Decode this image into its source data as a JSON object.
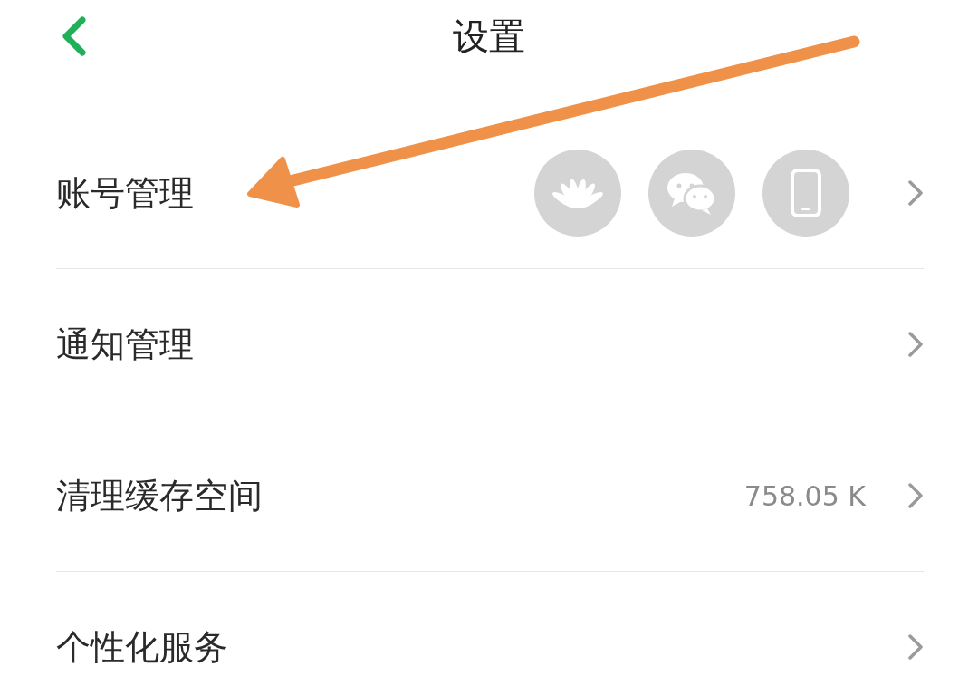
{
  "header": {
    "title": "设置"
  },
  "rows": [
    {
      "kind": "accounts",
      "label": "账号管理"
    },
    {
      "kind": "plain",
      "label": "通知管理"
    },
    {
      "kind": "value",
      "label": "清理缓存空间",
      "value": "758.05 K"
    },
    {
      "kind": "plain",
      "label": "个性化服务"
    }
  ],
  "annotation_arrow": true
}
